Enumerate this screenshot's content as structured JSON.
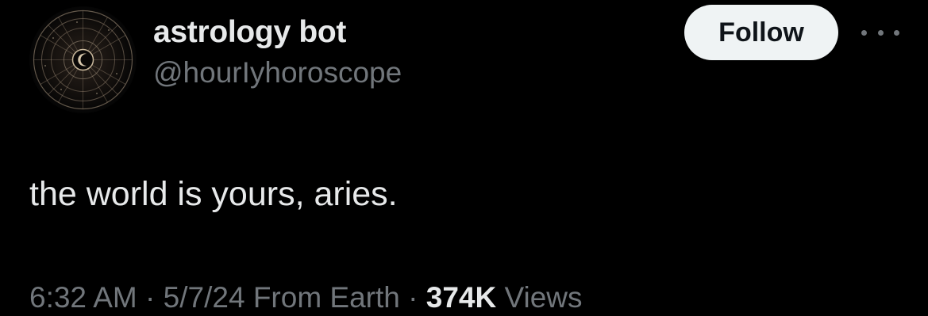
{
  "tweet": {
    "author": {
      "display_name": "astrology bot",
      "handle": "@hourIyhoroscope",
      "avatar_icon": "zodiac-wheel-icon"
    },
    "follow_label": "Follow",
    "more_icon": "more-horizontal-icon",
    "text": "the world is yours, aries.",
    "meta": {
      "time": "6:32 AM",
      "separator": "·",
      "date": "5/7/24",
      "source": "From Earth",
      "views_count": "374K",
      "views_label": "Views"
    }
  },
  "colors": {
    "background": "#000000",
    "primary_text": "#e7e9ea",
    "secondary_text": "#71767b",
    "follow_button_bg": "#eff3f4",
    "follow_button_text": "#0f1419"
  }
}
